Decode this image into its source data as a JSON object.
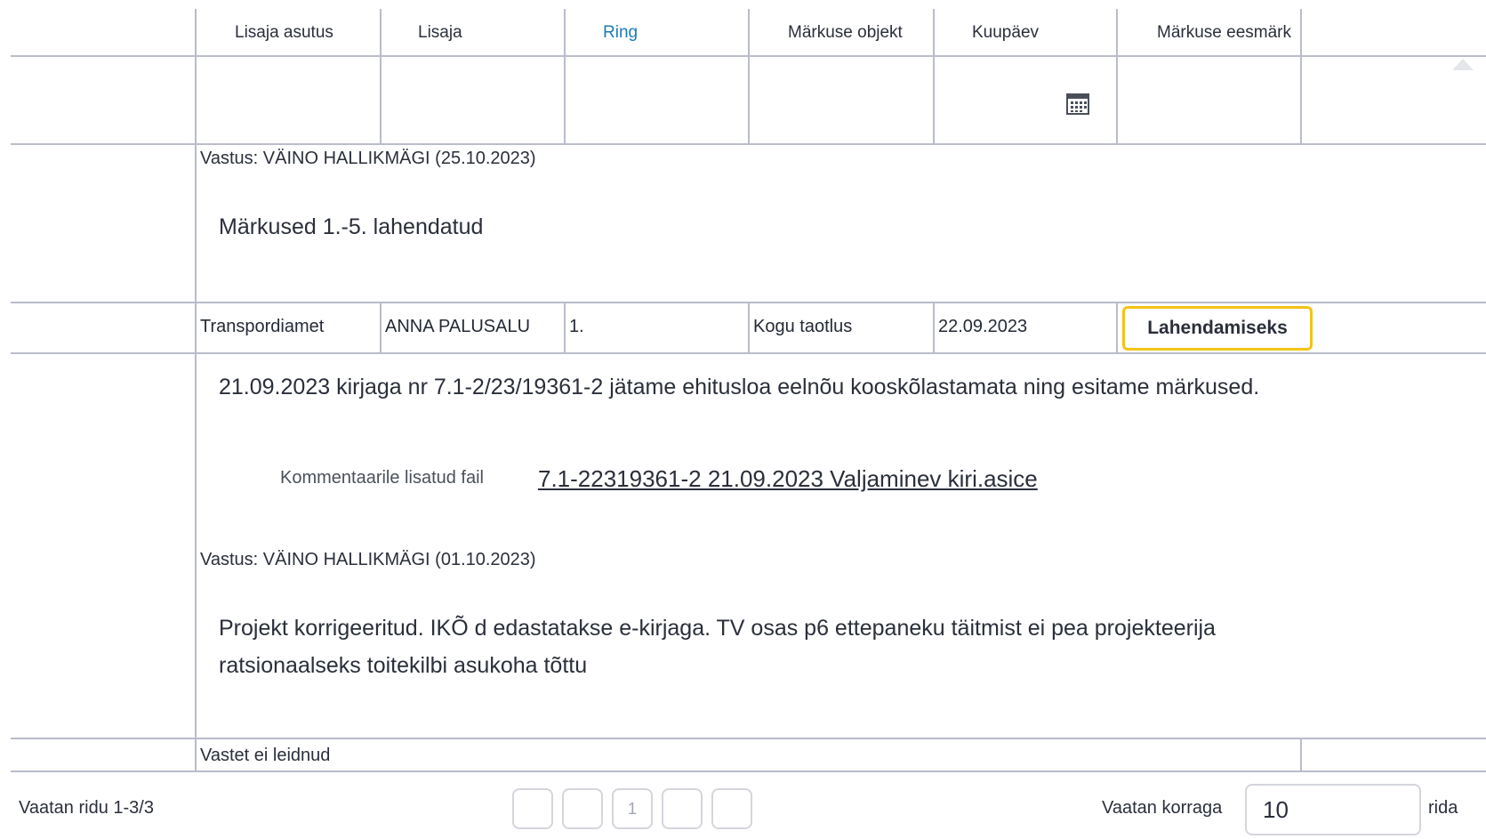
{
  "table": {
    "headers": [
      "Lisaja asutus",
      "Lisaja",
      "Ring",
      "Märkuse objekt",
      "Kuupäev",
      "Märkuse eesmärk"
    ],
    "active_header": "Ring",
    "filter_row": {
      "date_filter_icon": "calendar-icon"
    },
    "answer_top": {
      "label": "Vastus: VÄINO HALLIKMÄGI (25.10.2023)",
      "text": "Märkused 1.-5. lahendatud"
    },
    "row": {
      "asutus": "Transpordiamet",
      "lisaja": "ANNA PALUSALU",
      "ring": "1.",
      "objekt": "Kogu taotlus",
      "kuupaev": "22.09.2023",
      "eesmark": "Lahendamiseks"
    },
    "comment": "21.09.2023 kirjaga nr 7.1-2/23/19361-2 jätame ehitusloa eelnõu kooskõlastamata ning esitame märkused.",
    "attachment_label": "Kommentaarile lisatud fail",
    "attachment_link": "7.1-22319361-2 21.09.2023 Valjaminev kiri.asice",
    "answer_bottom": {
      "label": "Vastus: VÄINO HALLIKMÄGI (01.10.2023)",
      "line1": "Projekt korrigeeritud. IKÕ d edastatakse e-kirjaga. TV osas p6 ettepaneku täitmist ei pea projekteerija",
      "line2": "ratsionaalseks toitekilbi asukoha tõttu"
    },
    "no_result": "Vastet ei leidnud"
  },
  "footer": {
    "rows_info": "Vaatan ridu 1-3/3",
    "pages": [
      "",
      "",
      "1",
      "",
      ""
    ],
    "per_page_label": "Vaatan korraga",
    "per_page_value": "10",
    "per_page_suffix": "rida"
  },
  "colors": {
    "accent": "#1a7bb8",
    "badge_border": "#f3c316",
    "grid": "#b9bccb"
  }
}
